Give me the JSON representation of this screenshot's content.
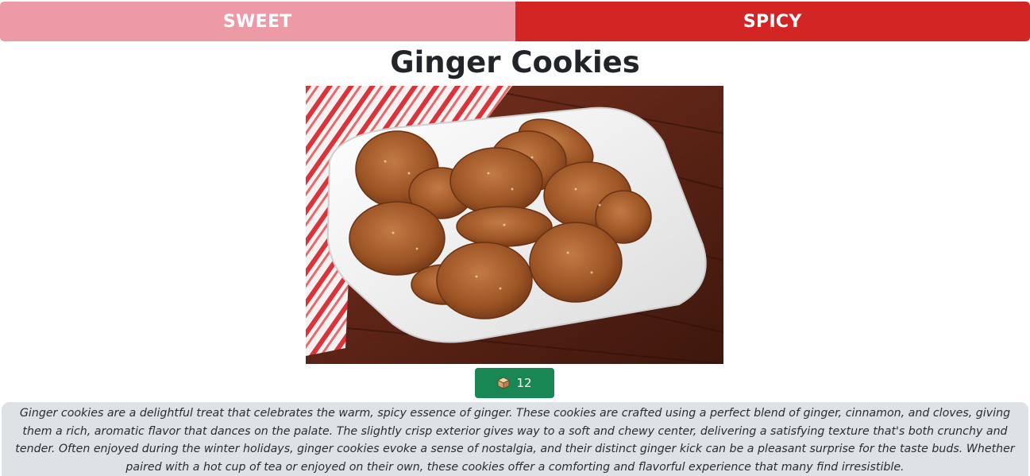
{
  "tabs": {
    "sweet_label": "SWEET",
    "spicy_label": "SPICY"
  },
  "recipe": {
    "title": "Ginger Cookies",
    "image_icon": "cookie-plate-photo",
    "count_icon": "box-icon",
    "count": "12",
    "description": "Ginger cookies are a delightful treat that celebrates the warm, spicy essence of ginger. These cookies are crafted using a perfect blend of ginger, cinnamon, and cloves, giving them a rich, aromatic flavor that dances on the palate. The slightly crisp exterior gives way to a soft and chewy center, delivering a satisfying texture that's both crunchy and tender. Often enjoyed during the winter holidays, ginger cookies evoke a sense of nostalgia, and their distinct ginger kick can be a pleasant surprise for the taste buds. Whether paired with a hot cup of tea or enjoyed on their own, these cookies offer a comforting and flavorful experience that many find irresistible."
  },
  "colors": {
    "sweet_tab": "#ec9aa6",
    "spicy_tab": "#d42525",
    "count_button": "#198754",
    "description_bg": "#dee1e5"
  }
}
